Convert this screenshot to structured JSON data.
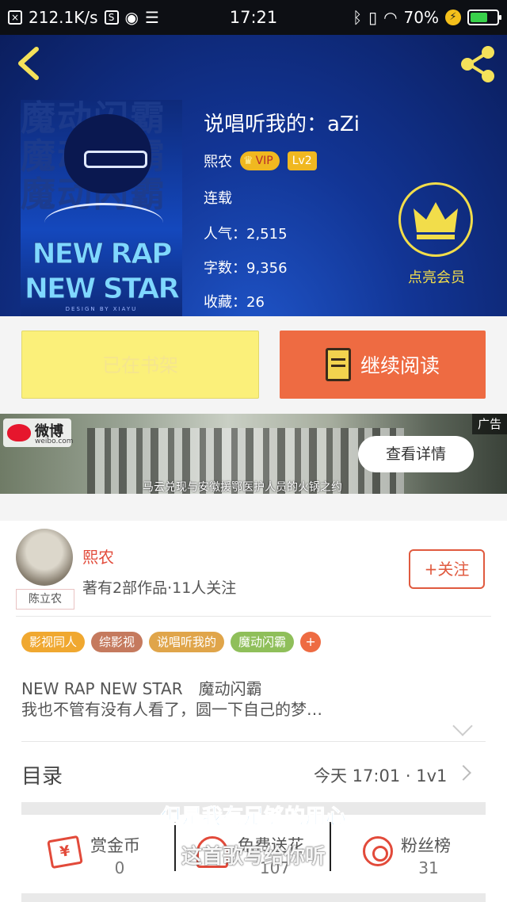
{
  "status_bar": {
    "net_speed": "212.1K/s",
    "time": "17:21",
    "battery": "70%",
    "battery_level": 0.7
  },
  "header": {
    "back_icon": "chevron-left-icon",
    "share_icon": "share-icon",
    "cover": {
      "bg_text": "魔动闪霸",
      "line1": "NEW RAP",
      "line2": "NEW STAR",
      "line3": "DESIGN BY XIAYU"
    },
    "title": "说唱听我的：aZi",
    "author": "熙农",
    "vip_label": "VIP",
    "level": "Lv2",
    "status": "连载",
    "popularity": "人气：2,515",
    "word_count": "字数：9,356",
    "favorites": "收藏：26",
    "member_label": "点亮会员",
    "accent_color": "#f2dd4a"
  },
  "actions": {
    "shelf_label": "已在书架",
    "read_label": "继续阅读"
  },
  "ad": {
    "brand": "微博",
    "brand_sub": "weibo.com",
    "tag": "广告",
    "detail_label": "查看详情",
    "caption": "马云兑现与安徽援鄂医护人员的火锅之约"
  },
  "author_card": {
    "avatar_tag": "陈立农",
    "name": "熙农",
    "meta": "著有2部作品·11人关注",
    "follow_label": "+关注",
    "tags": [
      {
        "label": "影视同人",
        "color": "#f0a830"
      },
      {
        "label": "综影视",
        "color": "#c57a5e"
      },
      {
        "label": "说唱听我的",
        "color": "#e0a54a"
      },
      {
        "label": "魔动闪霸",
        "color": "#8fbf5a"
      }
    ],
    "tag_more": "+",
    "intro_line1": "NEW RAP NEW STAR　魔动闪霸",
    "intro_line2": "我也不管有没有人看了，圆一下自己的梦…"
  },
  "toc": {
    "label": "目录",
    "latest": "今天 17:01 · 1v1"
  },
  "stats": {
    "coins_label": "赏金币",
    "coins_value": "0",
    "flowers_label": "免费送花",
    "flowers_value": "107",
    "fans_label": "粉丝榜",
    "fans_value": "31"
  },
  "subtitles": {
    "line1": "但是我有足够的用心",
    "line2": "这首歌写给你听"
  }
}
